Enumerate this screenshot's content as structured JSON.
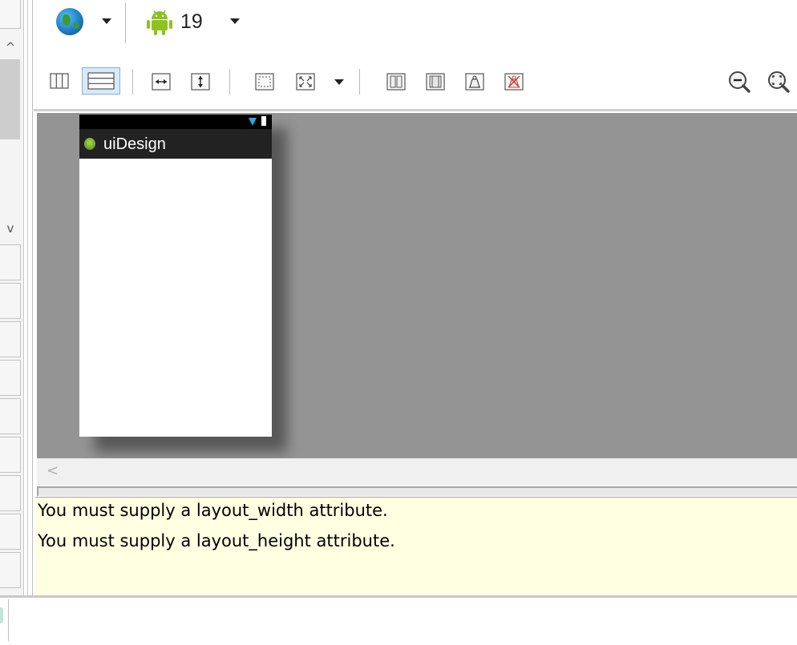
{
  "toolbar": {
    "locale_icon": "globe-icon",
    "api_icon": "android-icon",
    "api_level": "19",
    "layout_buttons": [
      {
        "name": "layout-columns-button",
        "icon": "columns-icon"
      },
      {
        "name": "layout-rows-button",
        "icon": "rows-icon",
        "active": true
      },
      {
        "name": "fill-width-button",
        "icon": "horizontal-arrows-icon"
      },
      {
        "name": "fill-height-button",
        "icon": "vertical-arrows-icon"
      },
      {
        "name": "show-bounds-button",
        "icon": "dashed-rect-icon"
      },
      {
        "name": "resize-button",
        "icon": "expand-icon"
      },
      {
        "name": "margins-button",
        "icon": "margins-icon"
      },
      {
        "name": "padding-button",
        "icon": "padding-icon"
      },
      {
        "name": "baseline-button",
        "icon": "weight-icon"
      },
      {
        "name": "clear-button",
        "icon": "clear-weight-icon"
      }
    ],
    "zoom_out_icon": "zoom-out-icon",
    "zoom_fit_icon": "zoom-fit-icon"
  },
  "device": {
    "app_title": "uiDesign"
  },
  "errors": {
    "line1": "You must supply a layout_width attribute.",
    "line2": "You must supply a layout_height attribute."
  },
  "scroll": {
    "left_arrow": "<",
    "up_arrow": "^",
    "down_arrow": "v"
  },
  "colors": {
    "canvas": "#949494",
    "error_bg": "#ffffe1",
    "action_bar": "#222222",
    "active_button": "#d8eaf8"
  }
}
